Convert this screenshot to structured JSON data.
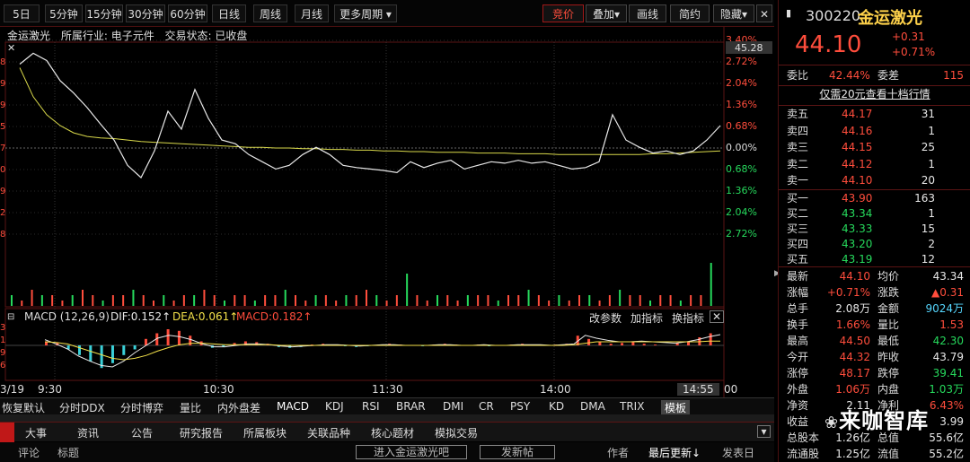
{
  "toolbar": {
    "periods": [
      "5日",
      "5分钟",
      "15分钟",
      "30分钟",
      "60分钟",
      "日线",
      "周线",
      "月线",
      "更多周期"
    ],
    "active": "5日",
    "right_buttons": [
      "竞价",
      "叠加",
      "画线",
      "简约",
      "隐藏"
    ]
  },
  "info": {
    "name": "金运激光",
    "industry": "所属行业: 电子元件",
    "status": "交易状态: 已收盘"
  },
  "chart_data": {
    "type": "line",
    "ylabels_left_price": [
      "8",
      "9",
      "9",
      "5",
      "7",
      "0",
      "9",
      "2",
      "8"
    ],
    "pct_ticks": [
      "3.40%",
      "2.72%",
      "2.04%",
      "1.36%",
      "0.68%",
      "0.00%",
      "0.68%",
      "1.36%",
      "2.04%",
      "2.72%"
    ],
    "pct_up_count": 5,
    "top_label": "45.28",
    "price_line": [
      44.95,
      45.1,
      45.0,
      44.72,
      44.55,
      44.35,
      44.12,
      43.9,
      43.55,
      43.38,
      43.75,
      44.3,
      44.05,
      44.6,
      44.2,
      43.9,
      43.85,
      43.7,
      43.6,
      43.5,
      43.55,
      43.7,
      43.8,
      43.7,
      43.55,
      43.52,
      43.5,
      43.48,
      43.45,
      43.6,
      43.52,
      43.58,
      43.62,
      43.5,
      43.55,
      43.6,
      43.58,
      43.62,
      43.58,
      43.6,
      43.55,
      43.5,
      43.52,
      43.6,
      44.25,
      43.9,
      43.8,
      43.72,
      43.75,
      43.7,
      43.75,
      43.9,
      44.1
    ],
    "avg_line": [
      44.9,
      44.5,
      44.25,
      44.1,
      44.0,
      43.95,
      43.93,
      43.92,
      43.9,
      43.88,
      43.87,
      43.86,
      43.85,
      43.84,
      43.83,
      43.82,
      43.81,
      43.8,
      43.8,
      43.79,
      43.79,
      43.78,
      43.78,
      43.77,
      43.77,
      43.76,
      43.76,
      43.75,
      43.75,
      43.74,
      43.74,
      43.73,
      43.73,
      43.73,
      43.72,
      43.72,
      43.72,
      43.71,
      43.71,
      43.71,
      43.7,
      43.7,
      43.7,
      43.7,
      43.7,
      43.7,
      43.7,
      43.71,
      43.71,
      43.72,
      43.73,
      43.74,
      43.75
    ],
    "prev_close": 43.79,
    "volumes": [
      2,
      1,
      3,
      2,
      2,
      1,
      2,
      3,
      2,
      1,
      2,
      2,
      3,
      2,
      1,
      2,
      1,
      2,
      2,
      3,
      2,
      1,
      2,
      2,
      1,
      2,
      2,
      3,
      2,
      1,
      2,
      2,
      1,
      2,
      2,
      3,
      2,
      1,
      2,
      6,
      2,
      1,
      2,
      2,
      1,
      2,
      2,
      2,
      1,
      2,
      2,
      3,
      2,
      1,
      2,
      1,
      2,
      2,
      1,
      2,
      3,
      2,
      2,
      1,
      2,
      2,
      1,
      2,
      2,
      8
    ],
    "macd_bars": [
      0.05,
      0.03,
      -0.05,
      -0.12,
      -0.2,
      -0.28,
      -0.22,
      -0.12,
      -0.05,
      0.08,
      0.15,
      0.2,
      0.18,
      0.12,
      0.05,
      -0.03,
      -0.02,
      0.03,
      0.05,
      0.04,
      0.02,
      -0.02,
      -0.03,
      -0.02,
      0.01,
      0.02,
      0.01,
      -0.01,
      -0.02,
      -0.01,
      0.01,
      0.02,
      0.01,
      0.0,
      -0.01,
      0.01,
      0.02,
      0.01,
      0.0,
      0.01,
      -0.01,
      0.0,
      0.01,
      0.02,
      0.01,
      0.0,
      0.01,
      0.02,
      0.12,
      0.08,
      0.05,
      0.02,
      0.03,
      0.04,
      0.02,
      0.01,
      0.0,
      0.03,
      0.05,
      0.1,
      0.15
    ],
    "macd_dif": [
      0.08,
      0.02,
      -0.05,
      -0.15,
      -0.22,
      -0.28,
      -0.3,
      -0.22,
      -0.1,
      0.0,
      0.1,
      0.14,
      0.12,
      0.08,
      0.02,
      -0.02,
      -0.02,
      0.0,
      0.02,
      0.02,
      0.01,
      -0.01,
      -0.02,
      -0.01,
      0.0,
      0.01,
      0.01,
      0.0,
      -0.01,
      0.0,
      0.01,
      0.01,
      0.0,
      0.0,
      0.0,
      0.01,
      0.01,
      0.0,
      0.0,
      0.01,
      0.0,
      0.0,
      0.01,
      0.01,
      0.01,
      0.0,
      0.01,
      0.02,
      0.14,
      0.1,
      0.07,
      0.05,
      0.05,
      0.06,
      0.05,
      0.04,
      0.03,
      0.05,
      0.08,
      0.12,
      0.15
    ],
    "macd_dea": [
      0.05,
      0.04,
      0.02,
      -0.03,
      -0.08,
      -0.13,
      -0.18,
      -0.2,
      -0.18,
      -0.14,
      -0.08,
      -0.03,
      0.01,
      0.03,
      0.03,
      0.02,
      0.01,
      0.01,
      0.01,
      0.01,
      0.01,
      0.0,
      0.0,
      0.0,
      0.0,
      0.0,
      0.0,
      0.0,
      0.0,
      0.0,
      0.0,
      0.0,
      0.0,
      0.0,
      0.0,
      0.0,
      0.0,
      0.0,
      0.0,
      0.0,
      0.0,
      0.0,
      0.0,
      0.0,
      0.0,
      0.0,
      0.0,
      0.01,
      0.03,
      0.05,
      0.05,
      0.05,
      0.05,
      0.05,
      0.05,
      0.05,
      0.05,
      0.05,
      0.05,
      0.06,
      0.06
    ]
  },
  "macd": {
    "title": "MACD (12,26,9)",
    "dif": "DIF:0.152↑",
    "dea": "DEA:0.061↑",
    "macd": "MACD:0.182↑",
    "buttons": [
      "改参数",
      "加指标",
      "换指标"
    ],
    "left_ticks": [
      "3",
      "1",
      "9",
      "6"
    ]
  },
  "xaxis": {
    "ticks": [
      "9:30",
      "10:30",
      "11:30",
      "14:00",
      "14:55"
    ],
    "left": "3/19",
    "right": "00"
  },
  "indicator_tabs": [
    "恢复默认",
    "分时DDX",
    "分时博弈",
    "量比",
    "内外盘差",
    "MACD",
    "KDJ",
    "RSI",
    "BRAR",
    "DMI",
    "CR",
    "PSY",
    "KD",
    "DMA",
    "TRIX",
    "模板"
  ],
  "info_tabs": [
    "大事",
    "资讯",
    "公告",
    "研究报告",
    "所属板块",
    "关联品种",
    "核心题材",
    "模拟交易"
  ],
  "comments": {
    "tab1": "评论",
    "tab2": "标题",
    "btn1": "进入金运激光吧",
    "btn2": "发新帖",
    "author": "作者",
    "latest": "最后更新↓",
    "publish": "发表日"
  },
  "quote": {
    "code": "300220",
    "name": "金运激光",
    "price": "44.10",
    "chg": "+0.31",
    "pct": "+0.71%",
    "wbl": "委比",
    "wbv": "42.44%",
    "wcl": "委差",
    "wcv": "115",
    "link": "仅需20元查看十档行情",
    "sells": [
      [
        "卖五",
        "44.17",
        "31"
      ],
      [
        "卖四",
        "44.16",
        "1"
      ],
      [
        "卖三",
        "44.15",
        "25"
      ],
      [
        "卖二",
        "44.12",
        "1"
      ],
      [
        "卖一",
        "44.10",
        "20"
      ]
    ],
    "buys": [
      [
        "买一",
        "43.90",
        "163"
      ],
      [
        "买二",
        "43.34",
        "1"
      ],
      [
        "买三",
        "43.33",
        "15"
      ],
      [
        "买四",
        "43.20",
        "2"
      ],
      [
        "买五",
        "43.19",
        "12"
      ]
    ],
    "stats": [
      [
        "最新",
        "44.10",
        "均价",
        "43.34"
      ],
      [
        "涨幅",
        "+0.71%",
        "涨跌",
        "▲0.31"
      ],
      [
        "总手",
        "2.08万",
        "金额",
        "9024万"
      ],
      [
        "换手",
        "1.66%",
        "量比",
        "1.53"
      ],
      [
        "最高",
        "44.50",
        "最低",
        "42.30"
      ],
      [
        "今开",
        "44.32",
        "昨收",
        "43.79"
      ],
      [
        "涨停",
        "48.17",
        "跌停",
        "39.41"
      ],
      [
        "外盘",
        "1.06万",
        "内盘",
        "1.03万"
      ],
      [
        "净资",
        "2.11",
        "净利",
        "6.43%"
      ],
      [
        "收益",
        "",
        "",
        "3.99"
      ],
      [
        "总股本",
        "1.26亿",
        "总值",
        "55.6亿"
      ],
      [
        "流通股",
        "1.25亿",
        "流值",
        "55.2亿"
      ]
    ]
  },
  "watermark": "来咖智库"
}
